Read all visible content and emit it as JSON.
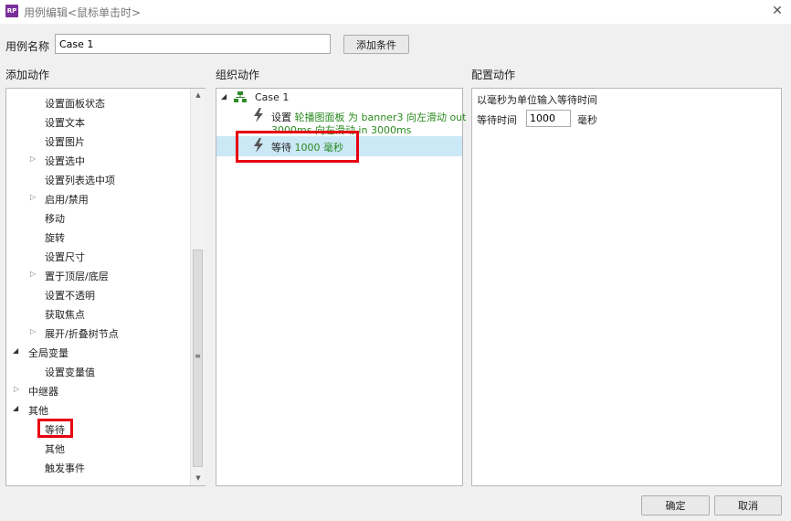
{
  "window": {
    "title": "用例编辑<鼠标单击时>",
    "app_icon_text": "RP",
    "close_glyph": "✕"
  },
  "case": {
    "name_label": "用例名称",
    "name_value": "Case 1",
    "add_condition_label": "添加条件"
  },
  "sections": {
    "add_action": "添加动作",
    "organize_action": "组织动作",
    "configure_action": "配置动作"
  },
  "add_action_tree": {
    "items": [
      {
        "label": "设置面板状态",
        "expander": ""
      },
      {
        "label": "设置文本",
        "expander": ""
      },
      {
        "label": "设置图片",
        "expander": ""
      },
      {
        "label": "设置选中",
        "expander": "collapsed"
      },
      {
        "label": "设置列表选中项",
        "expander": ""
      },
      {
        "label": "启用/禁用",
        "expander": "collapsed"
      },
      {
        "label": "移动",
        "expander": ""
      },
      {
        "label": "旋转",
        "expander": ""
      },
      {
        "label": "设置尺寸",
        "expander": ""
      },
      {
        "label": "置于顶层/底层",
        "expander": "collapsed"
      },
      {
        "label": "设置不透明",
        "expander": ""
      },
      {
        "label": "获取焦点",
        "expander": ""
      },
      {
        "label": "展开/折叠树节点",
        "expander": "collapsed"
      },
      {
        "label": "全局变量",
        "expander": "expanded"
      },
      {
        "label": "设置变量值",
        "expander": ""
      },
      {
        "label": "中继器",
        "expander": "collapsed"
      },
      {
        "label": "其他",
        "expander": "expanded"
      },
      {
        "label": "等待",
        "expander": ""
      },
      {
        "label": "其他",
        "expander": ""
      },
      {
        "label": "触发事件",
        "expander": ""
      }
    ]
  },
  "organize_tree": {
    "case_label": "Case 1",
    "action1_prefix": "设置",
    "action1_detail_line1": "轮播图面板 为 banner3 向左滑动 out",
    "action1_detail_line2": "3000ms 向左滑动 in 3000ms",
    "action2_prefix": "等待",
    "action2_detail": "1000 毫秒"
  },
  "configure": {
    "description": "以毫秒为单位输入等待时间",
    "wait_label": "等待时间",
    "wait_value": "1000",
    "unit_label": "毫秒"
  },
  "footer": {
    "ok_label": "确定",
    "cancel_label": "取消"
  },
  "colors": {
    "highlight_red": "#e60012",
    "selection_blue": "#cbe8f6",
    "action_green": "#2a8a1f",
    "app_icon_purple": "#7a2e9a"
  }
}
